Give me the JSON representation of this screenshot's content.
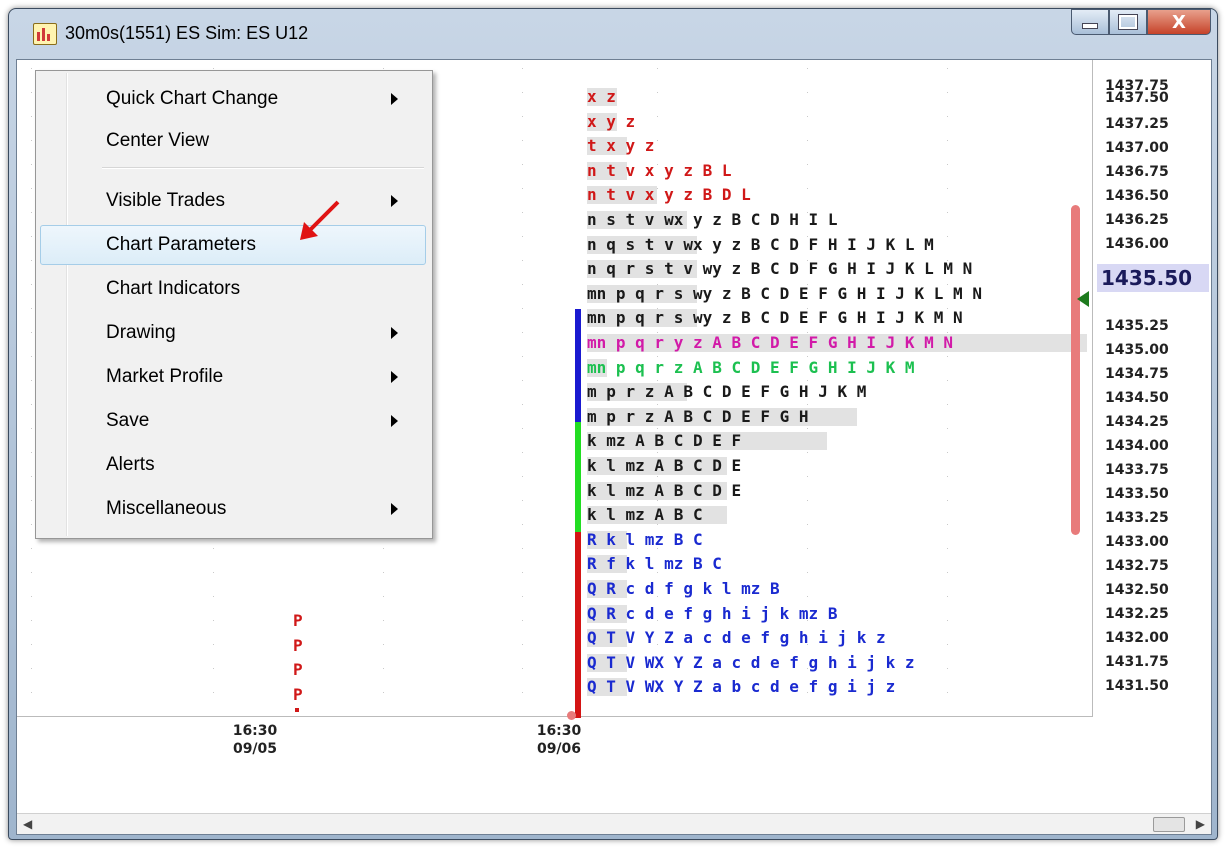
{
  "window": {
    "title": "30m0s(1551) ES Sim: ES U12",
    "icon": "chart-app-icon",
    "controls": [
      "minimize-icon",
      "maximize-icon",
      "close-icon"
    ],
    "close_label": "X"
  },
  "context_menu": {
    "items": [
      {
        "label": "Quick Chart Change",
        "submenu": true
      },
      {
        "label": "Center View",
        "submenu": false
      },
      {
        "label": "Visible Trades",
        "submenu": true
      },
      {
        "label": "Chart Parameters",
        "submenu": false,
        "highlighted": true
      },
      {
        "label": "Chart Indicators",
        "submenu": false
      },
      {
        "label": "Drawing",
        "submenu": true
      },
      {
        "label": "Market Profile",
        "submenu": true
      },
      {
        "label": "Save",
        "submenu": true
      },
      {
        "label": "Alerts",
        "submenu": false
      },
      {
        "label": "Miscellaneous",
        "submenu": true
      }
    ]
  },
  "profile": {
    "rows": [
      {
        "text": "x z",
        "color": "#d01818"
      },
      {
        "text": "x y z",
        "color": "#d01818"
      },
      {
        "text": "t x y z",
        "color": "#d01818"
      },
      {
        "text": "n t v x y z B L",
        "color": "#d01818"
      },
      {
        "text": "n t v x y z B D L",
        "color": "#d01818"
      },
      {
        "text": "n s t v wx y z B C D H I L",
        "color": "#1a1a1a"
      },
      {
        "text": "n q s t v wx y z B C D F H I J K L M",
        "color": "#1a1a1a"
      },
      {
        "text": "n q r s t v wy z B C D F G H I J K L M N",
        "color": "#1a1a1a"
      },
      {
        "text": "mn p q r s wy z B C D E F G H I J K L M N",
        "color": "#1a1a1a"
      },
      {
        "text": "mn p q r s wy z B C D E F G H I J K M N",
        "color": "#1a1a1a"
      },
      {
        "text": "mn p q r y z A B C D E F G H I J K M N",
        "color": "#d21aa8"
      },
      {
        "text": "mn p q r z A B C D E F G H I J K M",
        "color": "#1cc050"
      },
      {
        "text": "m p r z A B C D E F G H J K M",
        "color": "#1a1a1a"
      },
      {
        "text": "m p r z A B C D E F G H",
        "color": "#1a1a1a"
      },
      {
        "text": "k mz A B C D E F",
        "color": "#1a1a1a"
      },
      {
        "text": "k l mz A B C D E",
        "color": "#1a1a1a"
      },
      {
        "text": "k l mz A B C D E",
        "color": "#1a1a1a"
      },
      {
        "text": "k l mz A B C",
        "color": "#1a1a1a"
      },
      {
        "text": "R k l mz B C",
        "color": "#1a2ad0"
      },
      {
        "text": "R f k l mz B C",
        "color": "#1a2ad0"
      },
      {
        "text": "Q R c d f g k l mz B",
        "color": "#1a2ad0"
      },
      {
        "text": "Q R c d e f g h i j k mz B",
        "color": "#1a2ad0"
      },
      {
        "text": "Q T V Y Z a c d e f g h i j k z",
        "color": "#1a2ad0"
      },
      {
        "text": "Q T V WX Y Z a c d e f g h i j k z",
        "color": "#1a2ad0"
      },
      {
        "text": "Q T V WX Y Z a b c d e f g i j z",
        "color": "#1a2ad0"
      }
    ],
    "prior_day_letters": [
      "P",
      "P",
      "P",
      "P"
    ]
  },
  "price_axis": {
    "labels": [
      "1437.75",
      "1437.50",
      "1437.25",
      "1437.00",
      "1436.75",
      "1436.50",
      "1436.25",
      "1436.00",
      "1435.50",
      "1435.25",
      "1435.00",
      "1434.75",
      "1434.50",
      "1434.25",
      "1434.00",
      "1433.75",
      "1433.50",
      "1433.25",
      "1433.00",
      "1432.75",
      "1432.50",
      "1432.25",
      "1432.00",
      "1431.75",
      "1431.50"
    ],
    "current_price": "1435.50"
  },
  "time_axis": {
    "labels": [
      {
        "time": "16:30",
        "date": "09/05"
      },
      {
        "time": "16:30",
        "date": "09/06"
      }
    ]
  },
  "colors": {
    "value_area_blue": "#1a1ad0",
    "value_area_green": "#22dd22",
    "range_red": "#d41414",
    "range_bar": "#e87b7b"
  }
}
